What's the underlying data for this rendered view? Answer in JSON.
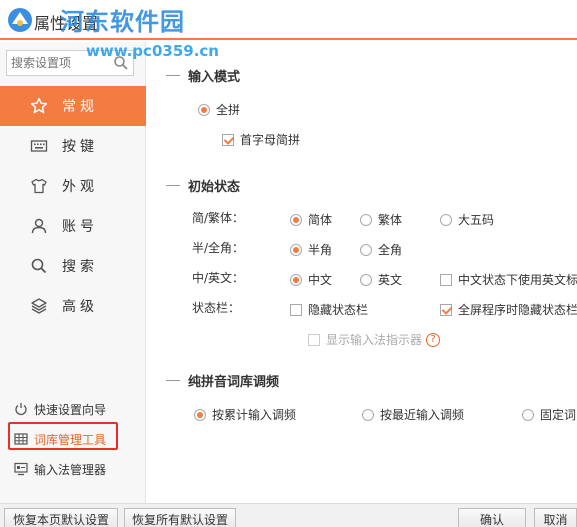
{
  "window": {
    "title": "属性设置",
    "watermark": "河东软件园",
    "watermark_url": "www.pc0359.cn"
  },
  "sidebar": {
    "search_placeholder": "搜索设置项",
    "nav": [
      {
        "label": "常规",
        "icon": "star-icon",
        "active": true
      },
      {
        "label": "按键",
        "icon": "keyboard-icon",
        "active": false
      },
      {
        "label": "外观",
        "icon": "shirt-icon",
        "active": false
      },
      {
        "label": "账号",
        "icon": "user-icon",
        "active": false
      },
      {
        "label": "搜索",
        "icon": "search-icon",
        "active": false
      },
      {
        "label": "高级",
        "icon": "layers-icon",
        "active": false
      }
    ],
    "tools": [
      {
        "label": "快速设置向导",
        "icon": "power-icon"
      },
      {
        "label": "词库管理工具",
        "icon": "grid-icon"
      },
      {
        "label": "输入法管理器",
        "icon": "monitor-icon"
      }
    ]
  },
  "main": {
    "input_mode": {
      "title": "输入模式",
      "quanpin": "全拼",
      "shouzimu": "首字母简拼"
    },
    "initial_state": {
      "title": "初始状态",
      "rows": [
        {
          "label": "简/繁体：",
          "options": [
            "简体",
            "繁体",
            "大五码"
          ]
        },
        {
          "label": "半/全角：",
          "options": [
            "半角",
            "全角"
          ]
        },
        {
          "label": "中/英文：",
          "options": [
            "中文",
            "英文",
            "中文状态下使用英文标"
          ]
        },
        {
          "label": "状态栏：",
          "options": [
            "隐藏状态栏",
            "全屏程序时隐藏状态栏"
          ]
        }
      ],
      "indicator": "显示输入法指示器",
      "help": "?"
    },
    "freq": {
      "title": "纯拼音词库调频",
      "options": [
        "按累计输入调频",
        "按最近输入调频",
        "固定词"
      ]
    }
  },
  "footer": {
    "restore_page": "恢复本页默认设置",
    "restore_all": "恢复所有默认设置",
    "ok": "确认",
    "cancel": "取消"
  },
  "colors": {
    "accent": "#f47b41",
    "highlight_box": "#e8302a"
  }
}
